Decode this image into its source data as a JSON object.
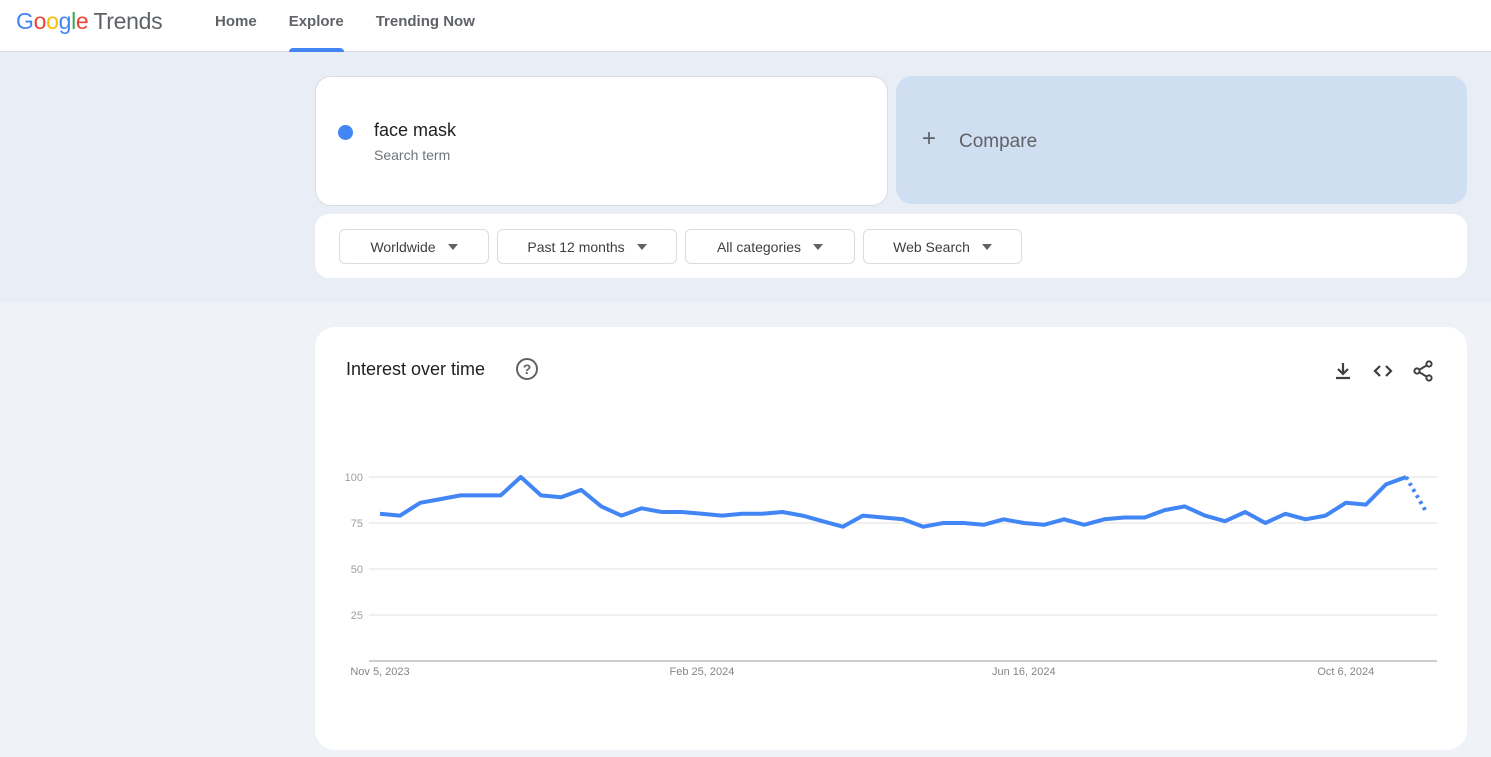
{
  "header": {
    "logo": {
      "google_letters": [
        "G",
        "o",
        "o",
        "g",
        "l",
        "e"
      ],
      "product": "Trends"
    },
    "nav": [
      {
        "label": "Home",
        "active": false
      },
      {
        "label": "Explore",
        "active": true
      },
      {
        "label": "Trending Now",
        "active": false
      }
    ]
  },
  "search": {
    "term": "face mask",
    "term_type": "Search term",
    "term_color": "#4285f4",
    "compare_label": "Compare",
    "compare_icon": "plus-icon"
  },
  "filters": [
    {
      "label": "Worldwide"
    },
    {
      "label": "Past 12 months"
    },
    {
      "label": "All categories"
    },
    {
      "label": "Web Search"
    }
  ],
  "interest_card": {
    "title": "Interest over time",
    "help_icon": "question-mark",
    "help_glyph": "?",
    "tools": [
      "download-icon",
      "embed-code-icon",
      "share-icon"
    ]
  },
  "chart_data": {
    "type": "line",
    "title": "Interest over time",
    "xlabel": "",
    "ylabel": "",
    "ylim": [
      0,
      100
    ],
    "yticks": [
      25,
      50,
      75,
      100
    ],
    "grid": true,
    "x_tick_labels": [
      "Nov 5, 2023",
      "Feb 25, 2024",
      "Jun 16, 2024",
      "Oct 6, 2024"
    ],
    "x_tick_indices": [
      0,
      16,
      32,
      48
    ],
    "series": [
      {
        "name": "face mask",
        "color": "#4285f4",
        "values": [
          80,
          79,
          86,
          88,
          90,
          90,
          90,
          100,
          90,
          89,
          93,
          84,
          79,
          83,
          81,
          81,
          80,
          79,
          80,
          80,
          81,
          79,
          76,
          73,
          79,
          78,
          77,
          73,
          75,
          75,
          74,
          77,
          75,
          74,
          77,
          74,
          77,
          78,
          78,
          82,
          84,
          79,
          76,
          81,
          75,
          80,
          77,
          79,
          86,
          85,
          96,
          100,
          81
        ],
        "partial_last_point": true
      }
    ]
  }
}
